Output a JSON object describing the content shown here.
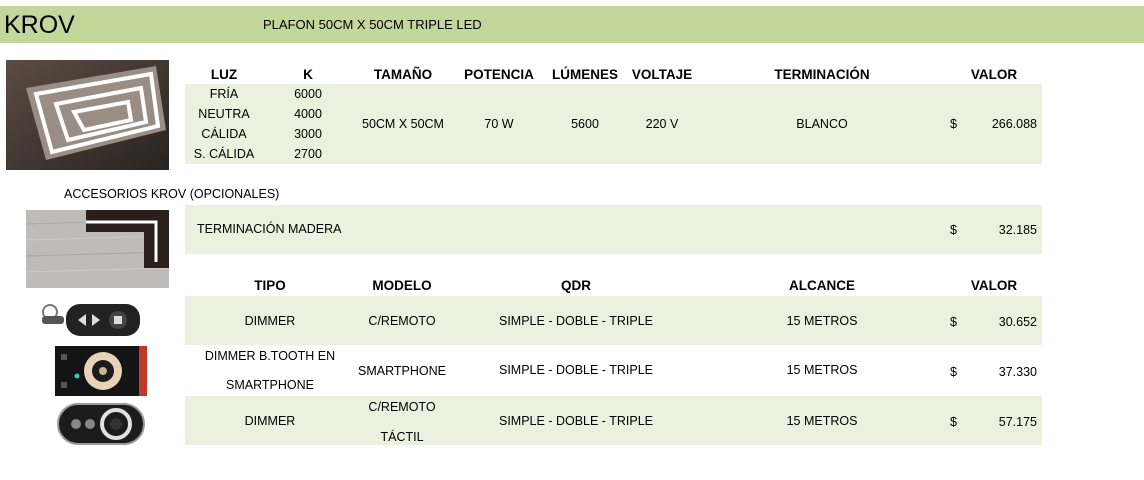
{
  "header": {
    "brand": "KROV",
    "product_title": "PLAFON 50CM X 50CM TRIPLE LED"
  },
  "main_table": {
    "columns": [
      "LUZ",
      "K",
      "TAMAÑO",
      "POTENCIA",
      "LÚMENES",
      "VOLTAJE",
      "TERMINACIÓN",
      "VALOR"
    ],
    "luz": [
      "FRÍA",
      "NEUTRA",
      "CÁLIDA",
      "S. CÁLIDA"
    ],
    "k": [
      "6000",
      "4000",
      "3000",
      "2700"
    ],
    "tamano": "50CM X 50CM",
    "potencia": "70 W",
    "lumenes": "5600",
    "voltaje": "220 V",
    "terminacion": "BLANCO",
    "currency": "$",
    "valor": "266.088"
  },
  "accessories": {
    "title": "ACCESORIOS KROV (OPCIONALES)",
    "wood": {
      "label": "TERMINACIÓN MADERA",
      "currency": "$",
      "valor": "32.185"
    },
    "columns": [
      "TIPO",
      "MODELO",
      "QDR",
      "ALCANCE",
      "VALOR"
    ],
    "rows": [
      {
        "tipo": [
          "DIMMER"
        ],
        "modelo": [
          "C/REMOTO"
        ],
        "qdr": "SIMPLE - DOBLE - TRIPLE",
        "alcance": "15 METROS",
        "currency": "$",
        "valor": "30.652"
      },
      {
        "tipo": [
          "DIMMER B.TOOTH EN",
          "SMARTPHONE"
        ],
        "modelo": [
          "SMARTPHONE"
        ],
        "qdr": "SIMPLE - DOBLE - TRIPLE",
        "alcance": "15 METROS",
        "currency": "$",
        "valor": "37.330"
      },
      {
        "tipo": [
          "DIMMER"
        ],
        "modelo": [
          "C/REMOTO",
          "TÁCTIL"
        ],
        "qdr": "SIMPLE - DOBLE - TRIPLE",
        "alcance": "15 METROS",
        "currency": "$",
        "valor": "57.175"
      }
    ]
  },
  "colors": {
    "header_bar": "#c4d79b",
    "row_band": "#ebf1de"
  }
}
